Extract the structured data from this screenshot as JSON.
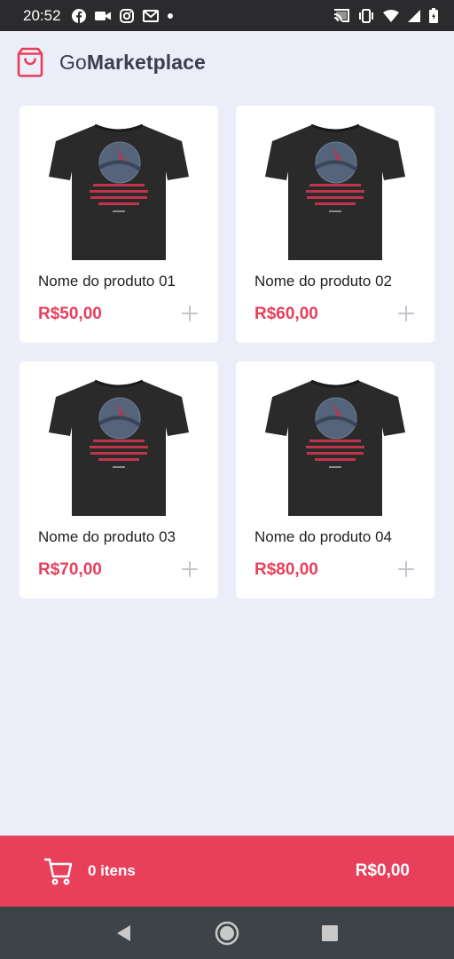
{
  "status_bar": {
    "time": "20:52"
  },
  "header": {
    "brand_prefix": "Go",
    "brand_suffix": "Marketplace"
  },
  "products": [
    {
      "title": "Nome do produto 01",
      "price": "R$50,00"
    },
    {
      "title": "Nome do produto 02",
      "price": "R$60,00"
    },
    {
      "title": "Nome do produto 03",
      "price": "R$70,00"
    },
    {
      "title": "Nome do produto 04",
      "price": "R$80,00"
    }
  ],
  "cart": {
    "count_label": "0 itens",
    "total": "R$0,00"
  },
  "colors": {
    "accent": "#e83f5b",
    "background": "#ebeef8",
    "status_bar": "#2b2b2e",
    "nav_bar": "#3d4346"
  },
  "icons": {
    "logo": "shopping-bag-icon",
    "add": "plus-icon",
    "cart": "shopping-cart-icon",
    "nav_back": "back-triangle-icon",
    "nav_home": "home-circle-icon",
    "nav_recents": "recents-square-icon"
  }
}
